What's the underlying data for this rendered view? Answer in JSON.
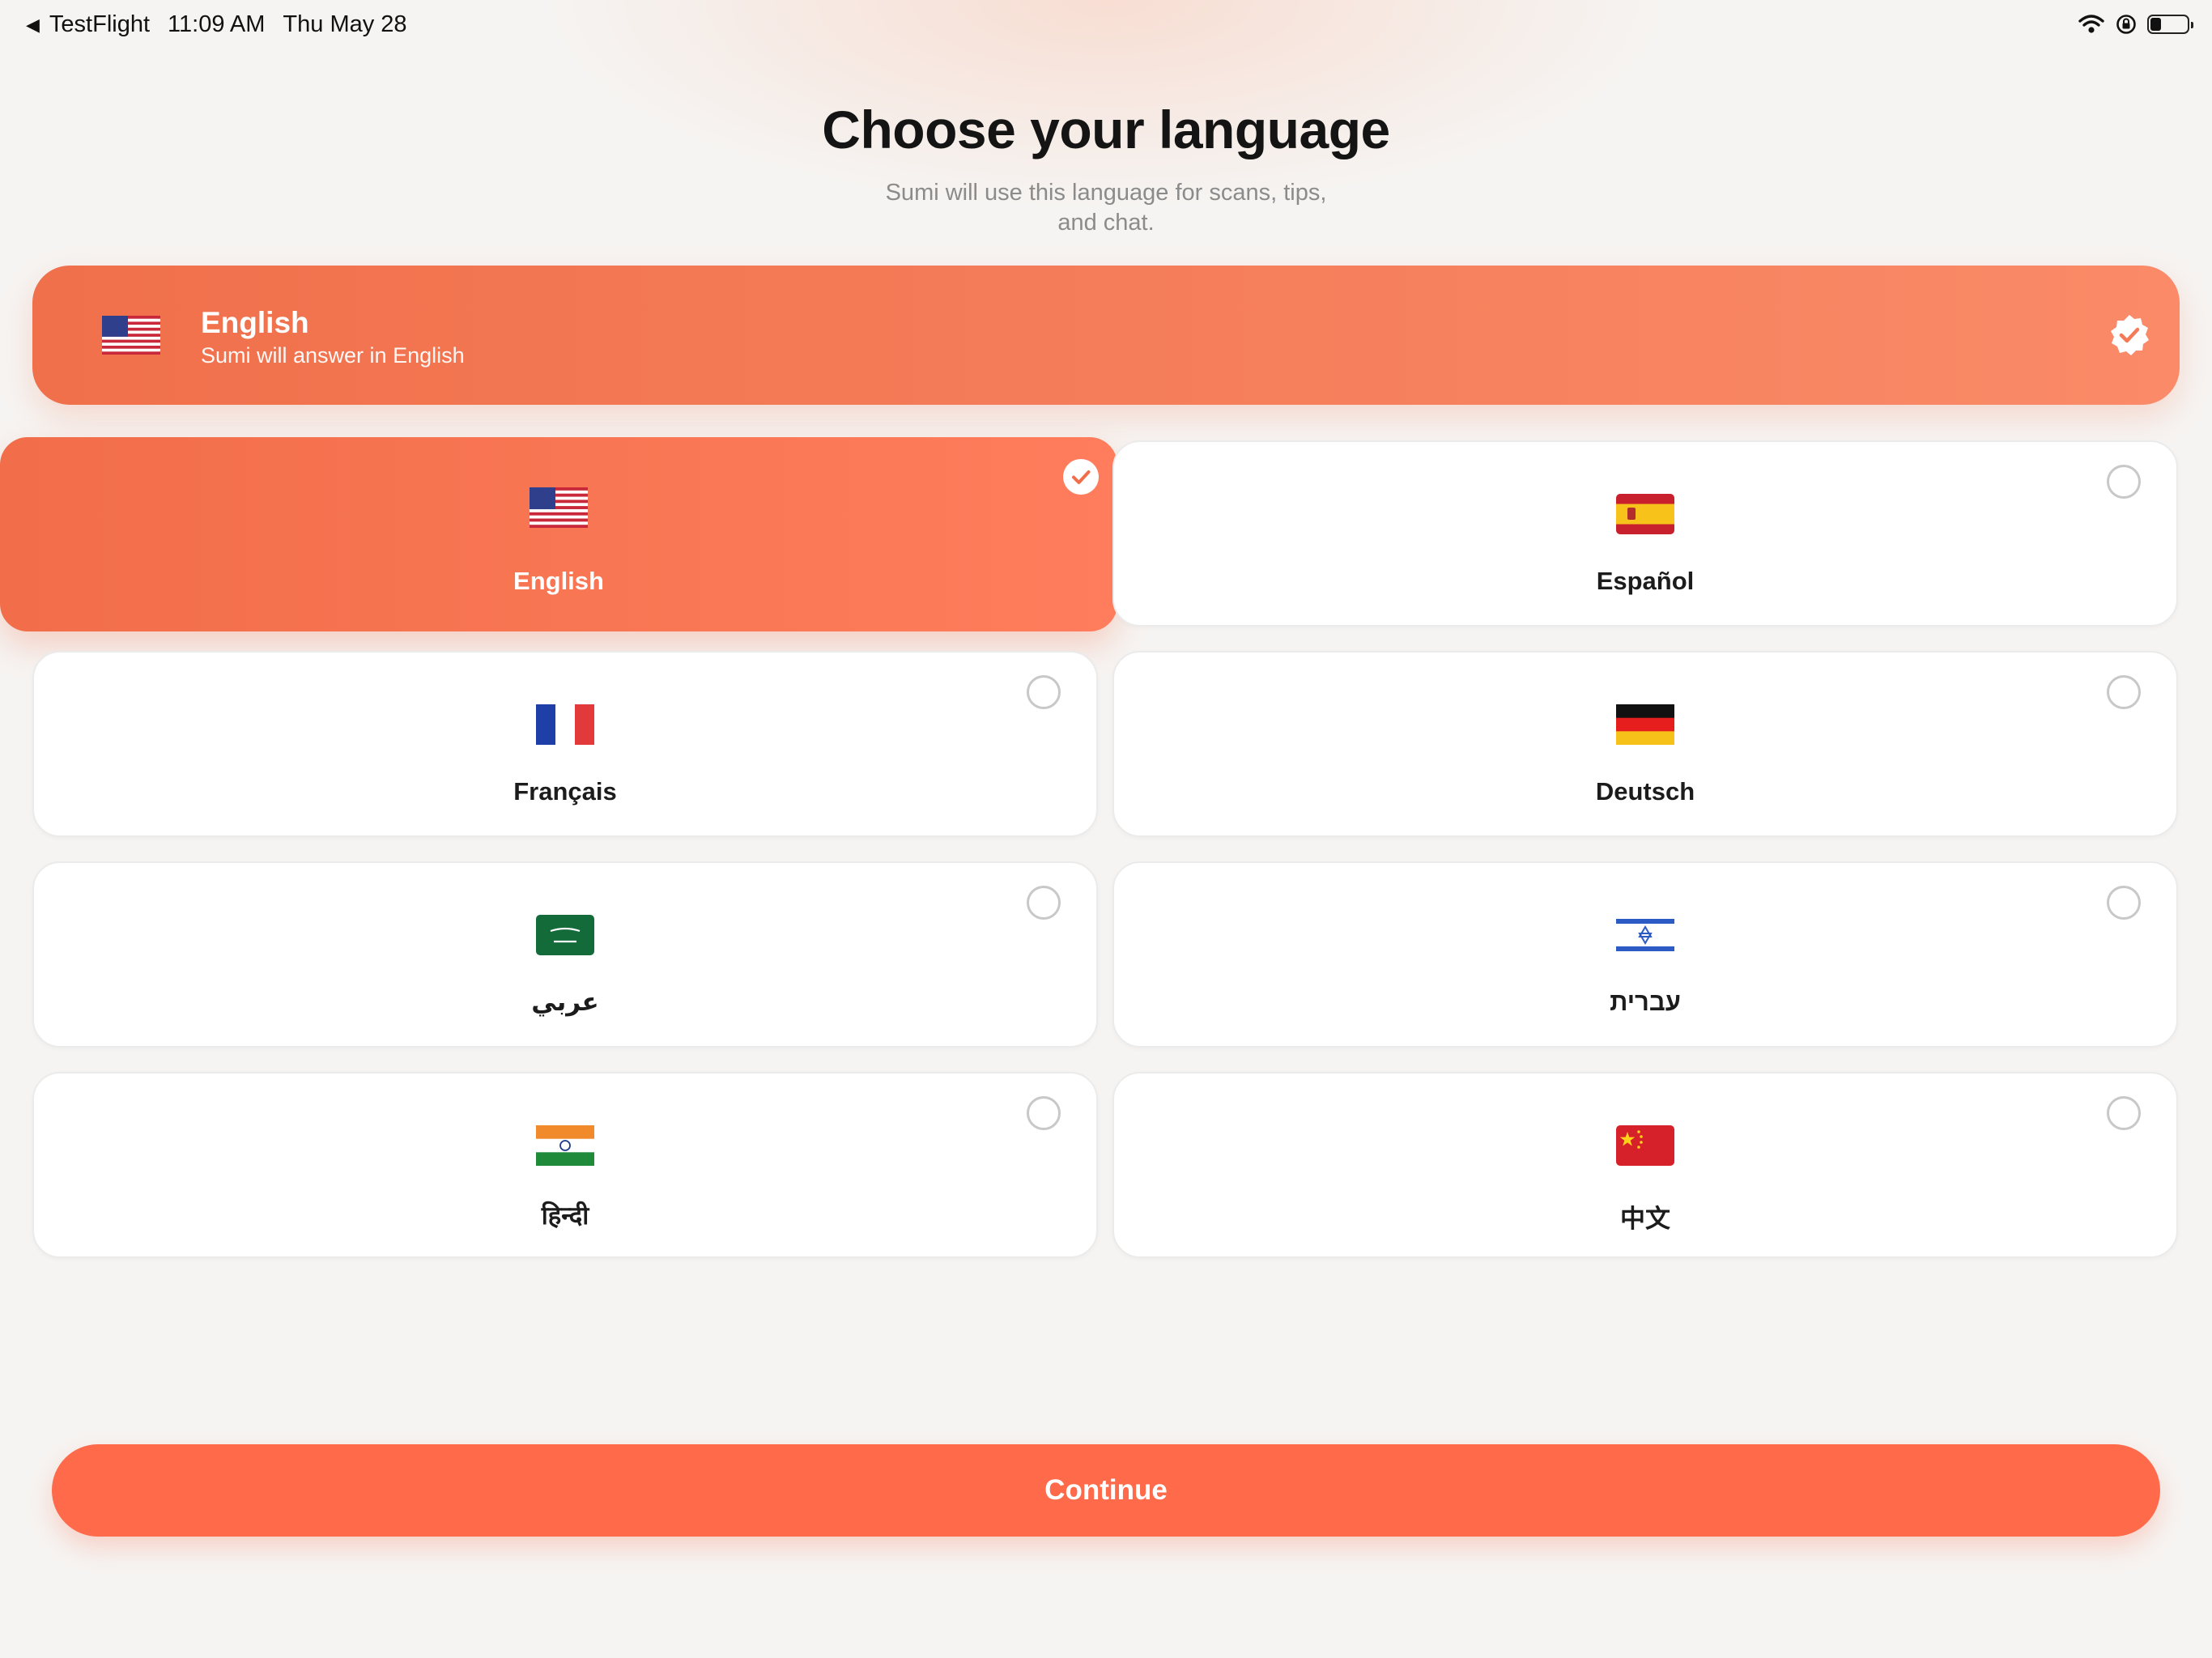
{
  "status_bar": {
    "back_app": "TestFlight",
    "time": "11:09 AM",
    "date": "Thu May 28",
    "battery_level": 0.3
  },
  "header": {
    "title": "Choose your language",
    "subtitle": "Sumi will use this language for scans, tips, and chat."
  },
  "summary": {
    "flag": "us-flag",
    "title": "English",
    "subtitle": "Sumi will answer in English",
    "icon": "verified-check-icon"
  },
  "languages": [
    {
      "label": "English",
      "flag": "us-flag",
      "selected": true
    },
    {
      "label": "Español",
      "flag": "spain-flag",
      "selected": false
    },
    {
      "label": "Français",
      "flag": "france-flag",
      "selected": false
    },
    {
      "label": "Deutsch",
      "flag": "germany-flag",
      "selected": false
    },
    {
      "label": "عربي",
      "flag": "saudi-arabia-flag",
      "selected": false
    },
    {
      "label": "עברית",
      "flag": "israel-flag",
      "selected": false
    },
    {
      "label": "हिन्दी",
      "flag": "india-flag",
      "selected": false
    },
    {
      "label": "中文",
      "flag": "china-flag",
      "selected": false
    }
  ],
  "continue_label": "Continue",
  "colors": {
    "accent": "#ff6a4a",
    "accent_gradient_start": "#f0704b",
    "accent_gradient_end": "#fa8a68",
    "background": "#f6f4f2",
    "text_primary": "#141414",
    "text_secondary": "#8b8b8b"
  }
}
